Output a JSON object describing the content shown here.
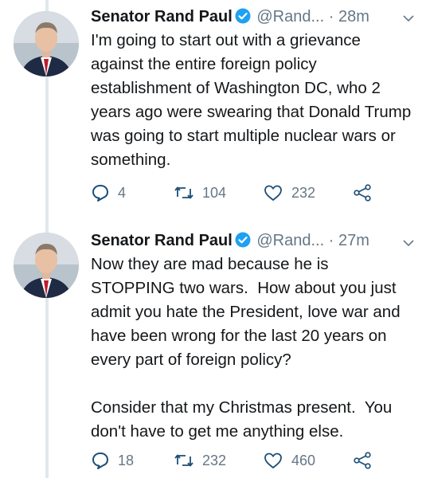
{
  "tweets": [
    {
      "author_name": "Senator Rand Paul",
      "handle": "@Rand...",
      "time": "· 28m",
      "text": "I'm going to start out with a grievance against the entire foreign policy establishment of Washington DC, who 2 years ago were swearing that Donald Trump was going to start multiple nuclear wars or something.",
      "replies": "4",
      "retweets": "104",
      "likes": "232"
    },
    {
      "author_name": "Senator Rand Paul",
      "handle": "@Rand...",
      "time": "· 27m",
      "text": "Now they are mad because he is STOPPING two wars.  How about you just admit you hate the President, love war and have been wrong for the last 20 years on every part of foreign policy?\n\nConsider that my Christmas present.  You don't have to get me anything else.",
      "replies": "18",
      "retweets": "232",
      "likes": "460"
    }
  ],
  "colors": {
    "verified_badge": "#1da1f2",
    "secondary_text": "#657786",
    "thread_line": "#e1e8ed"
  },
  "icons": [
    "verified-icon",
    "caret-down-icon",
    "reply-icon",
    "retweet-icon",
    "like-icon",
    "share-icon"
  ]
}
